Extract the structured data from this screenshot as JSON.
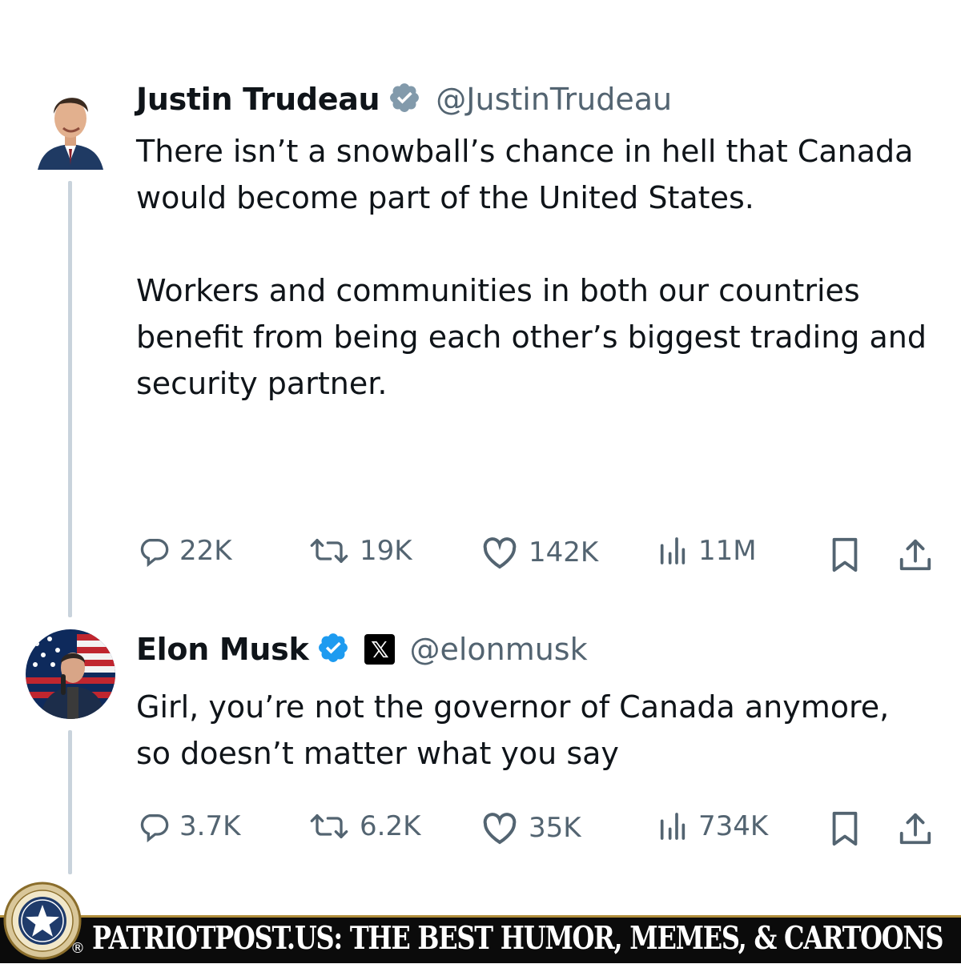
{
  "tweets": [
    {
      "name": "Justin Trudeau",
      "handle": "@JustinTrudeau",
      "verified": "grey-verified-badge",
      "text": [
        "There isn’t a snowball’s chance in hell that Canada would become part of the United States.",
        "Workers and communities in both our countries benefit from being each other’s biggest trading and security partner."
      ],
      "stats": {
        "replies": "22K",
        "reposts": "19K",
        "likes": "142K",
        "views": "11M"
      }
    },
    {
      "name": "Elon Musk",
      "handle": "@elonmusk",
      "verified": "blue-verified-badge",
      "affiliate_badge": "𝕏",
      "text": [
        "Girl, you’re not the governor of Canada anymore, so doesn’t matter what you say"
      ],
      "stats": {
        "replies": "3.7K",
        "reposts": "6.2K",
        "likes": "35K",
        "views": "734K"
      }
    }
  ],
  "footer": {
    "banner_text": "PATRIOTPOST.US: THE BEST HUMOR, MEMES, & CARTOONS",
    "registered_mark": "®",
    "seal_icon": "star-seal-logo"
  },
  "colors": {
    "text": "#0f1419",
    "secondary": "#536471",
    "blue_badge": "#1d9bf0",
    "grey_badge": "#829aab",
    "thread_line": "#c9d3dc",
    "banner_bg": "#0b0b0b"
  }
}
